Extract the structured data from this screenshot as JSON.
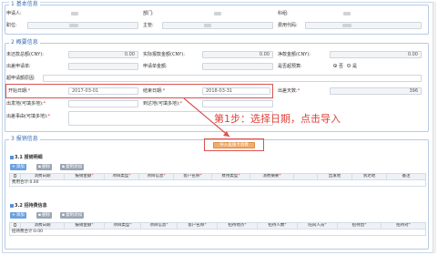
{
  "section1": {
    "legend": "1 基本信息",
    "applicant_label": "申请人:",
    "dept_label": "部门:",
    "subject_label": "科组:",
    "position_label": "职位:",
    "supervisor_label": "主管:",
    "cost_code_label": "费用代码:"
  },
  "section2": {
    "legend": "2 概要信息",
    "unreimbursed_label": "未还款总额(CNY):",
    "unreimbursed_value": "0.00",
    "actual_label": "实际报款金额(CNY):",
    "actual_value": "0.00",
    "net_label": "净款金额(CNY):",
    "net_value": "0.00",
    "trip_apply_label": "出差申请单:",
    "apply_amount_label": "申请单金额:",
    "over_budget_label": "是否超预算:",
    "over_yes": "否",
    "over_no": "是",
    "over_reason_label": "超申请额原因:",
    "start_label": "开始日期:",
    "start_value": "2017-03-01",
    "end_label": "结束日期:",
    "end_value": "2018-03-31",
    "days_label": "出差天数:",
    "days_value": "396",
    "from_label": "出发地(可填多地):",
    "to_label": "到达地(可填多地):",
    "reason_label": "出差事由(可填多地):"
  },
  "annotation": {
    "step_text": "第1步：选择日期，点击导入"
  },
  "section3": {
    "legend": "3 报销信息",
    "import_button": "导入差旅卡消费",
    "sub1_title": "3.1 报销明细",
    "add_label": "添加",
    "delete_label": "删除",
    "import_add_label": "复制添加",
    "table1_headers": [
      "",
      "消费日期",
      "报销金额",
      "项目类型",
      "项目信息",
      "客户名称",
      "费用类型",
      "消费摘要",
      "",
      "出发地",
      "到达地",
      "备注"
    ],
    "table1_total": "费用合计:0.00",
    "sub2_title": "3.2 招待费信息",
    "table2_headers": [
      "",
      "消费日期",
      "报销金额",
      "项目类型",
      "项目信息",
      "客户名称",
      "招待地点",
      "招待人数",
      "陪同人员",
      "招待因",
      "招待对"
    ],
    "table2_total": "招待费合计:0.00"
  },
  "colors": {
    "accent": "#3a6fb4",
    "highlight": "#d9534f",
    "annotation": "#e0403a",
    "import_button": "#f0ad6e"
  }
}
